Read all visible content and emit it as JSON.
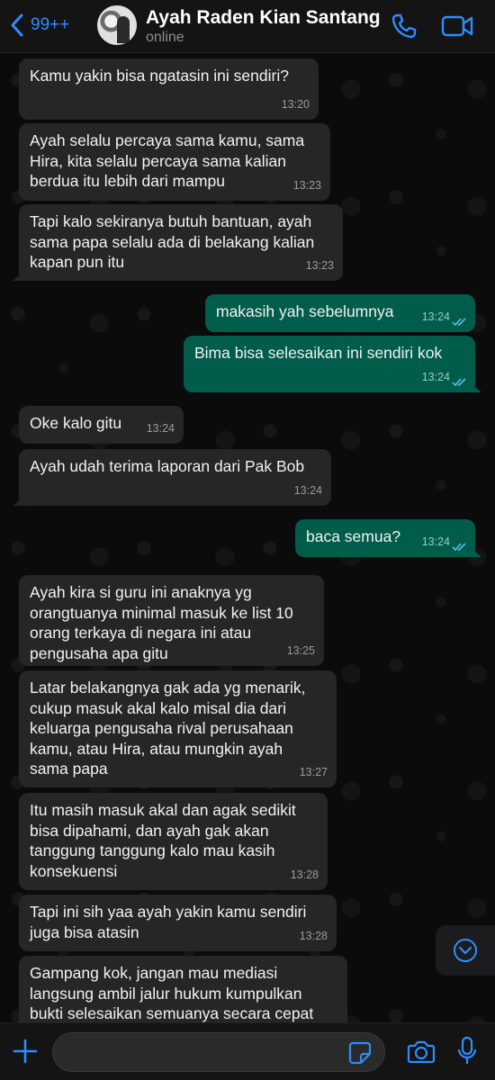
{
  "header": {
    "back_count": "99++",
    "contact_name": "Ayah Raden Kian Santang",
    "status": "online"
  },
  "messages": [
    {
      "dir": "in",
      "text": "Kamu yakin bisa ngatasin ini sendiri?",
      "time": "13:20"
    },
    {
      "dir": "in",
      "text": "Ayah selalu percaya sama kamu, sama\nHira, kita selalu percaya sama kalian\nberdua itu lebih dari mampu",
      "time": "13:23"
    },
    {
      "dir": "in",
      "text": "Tapi kalo sekiranya butuh bantuan, ayah\nsama papa selalu ada di belakang kalian\nkapan pun itu",
      "time": "13:23"
    },
    {
      "dir": "out",
      "text": "makasih yah sebelumnya",
      "time": "13:24"
    },
    {
      "dir": "out",
      "text": "Bima bisa selesaikan ini sendiri kok",
      "time": "13:24"
    },
    {
      "dir": "in",
      "text": "Oke kalo gitu",
      "time": "13:24"
    },
    {
      "dir": "in",
      "text": "Ayah udah terima laporan dari Pak Bob",
      "time": "13:24"
    },
    {
      "dir": "out",
      "text": "baca semua?",
      "time": "13:24"
    },
    {
      "dir": "in",
      "text": "Ayah kira si guru ini anaknya yg\norangtuanya minimal masuk ke list 10\norang terkaya di negara ini atau\npengusaha apa gitu",
      "time": "13:25"
    },
    {
      "dir": "in",
      "text": "Latar belakangnya gak ada yg menarik,\ncukup masuk akal kalo misal dia dari\nkeluarga pengusaha rival perusahaan\nkamu, atau Hira, atau mungkin ayah\nsama papa",
      "time": "13:27"
    },
    {
      "dir": "in",
      "text": "Itu masih masuk akal dan agak sedikit\nbisa dipahami, dan ayah gak akan\ntanggung tanggung kalo mau kasih\nkonsekuensi",
      "time": "13:28"
    },
    {
      "dir": "in",
      "text": "Tapi ini sih yaa ayah yakin kamu sendiri\njuga bisa atasin",
      "time": "13:28"
    },
    {
      "dir": "in",
      "text": "Gampang kok, jangan mau mediasi\nlangsung ambil jalur hukum kumpulkan\nbukti selesaikan semuanya secara cepat",
      "time": ""
    }
  ],
  "composer": {
    "value": "",
    "placeholder": ""
  },
  "colors": {
    "accent": "#2f8cff",
    "outgoing": "#005c4b",
    "incoming": "#262626"
  },
  "icons": [
    "chevron-left-icon",
    "phone-icon",
    "video-camera-icon",
    "chevron-down-icon",
    "plus-icon",
    "sticker-icon",
    "camera-icon",
    "microphone-icon",
    "double-check-icon"
  ]
}
